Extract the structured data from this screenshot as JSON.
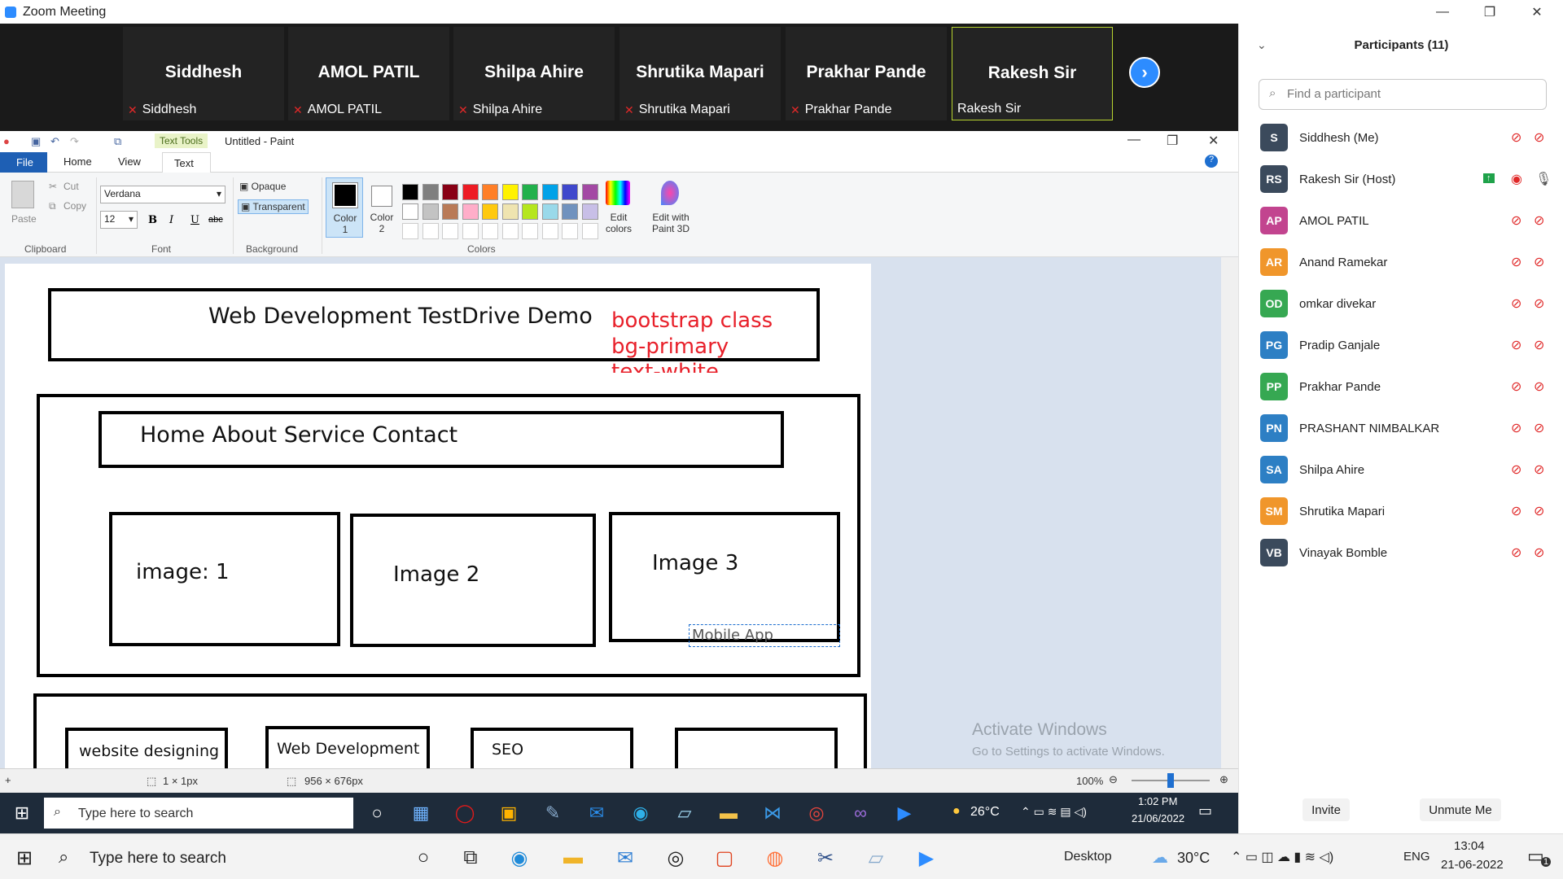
{
  "zoom": {
    "title": "Zoom Meeting",
    "minimize": "—",
    "restore": "❐",
    "close": "✕"
  },
  "strip": {
    "tiles": [
      {
        "name": "Siddhesh",
        "label": "Siddhesh",
        "muted": true
      },
      {
        "name": "AMOL PATIL",
        "label": "AMOL PATIL",
        "muted": true
      },
      {
        "name": "Shilpa Ahire",
        "label": "Shilpa Ahire",
        "muted": true
      },
      {
        "name": "Shrutika Mapari",
        "label": "Shrutika Mapari",
        "muted": true
      },
      {
        "name": "Prakhar Pande",
        "label": "Prakhar Pande",
        "muted": true
      },
      {
        "name": "Rakesh Sir",
        "label": "Rakesh Sir",
        "muted": false
      }
    ],
    "next": "›"
  },
  "paint": {
    "title": "Untitled - Paint",
    "tools_tab": "Text Tools",
    "tabs": {
      "file": "File",
      "home": "Home",
      "view": "View",
      "text": "Text"
    },
    "clipboard": {
      "paste": "Paste",
      "cut": "Cut",
      "copy": "Copy",
      "group": "Clipboard"
    },
    "font": {
      "family": "Verdana",
      "size": "12",
      "bold": "B",
      "italic": "I",
      "underline": "U",
      "strike": "abc",
      "group": "Font"
    },
    "background": {
      "opaque": "Opaque",
      "transparent": "Transparent",
      "group": "Background"
    },
    "colors": {
      "color1": "Color 1",
      "color2": "Color 2",
      "edit": "Edit colors",
      "paint3d": "Edit with Paint 3D",
      "group": "Colors",
      "row1": [
        "#000000",
        "#7f7f7f",
        "#880015",
        "#ed1c24",
        "#ff7f27",
        "#fff200",
        "#22b14c",
        "#00a2e8",
        "#3f48cc",
        "#a349a4"
      ],
      "row2": [
        "#ffffff",
        "#c3c3c3",
        "#b97a57",
        "#ffaec9",
        "#ffc90e",
        "#efe4b0",
        "#b5e61d",
        "#99d9ea",
        "#7092be",
        "#c8bfe7"
      ]
    },
    "canvas": {
      "header": "Web Development TestDrive Demo",
      "note1": "bootstrap class",
      "note2": "bg-primary",
      "note3": "text-white",
      "nav": "Home About Service Contact",
      "img1": "image: 1",
      "img2": "Image 2",
      "img3": "Image 3",
      "textbox": "Mobile App",
      "svc1": "website designing",
      "svc2": "Web Development",
      "svc3": "SEO",
      "watermark1": "Activate Windows",
      "watermark2": "Go to Settings to activate Windows."
    },
    "status": {
      "pixel": "1 × 1px",
      "size": "956 × 676px",
      "zoom": "100%"
    }
  },
  "innerTaskbar": {
    "search": "Type here to search",
    "weather": "26°C",
    "time": "1:02 PM",
    "date": "21/06/2022"
  },
  "participants": {
    "title": "Participants (11)",
    "search_placeholder": "Find a participant",
    "list": [
      {
        "initials": "S",
        "name": "Siddhesh (Me)",
        "color": "#3b4a5c"
      },
      {
        "initials": "RS",
        "name": "Rakesh Sir (Host)",
        "color": "#3b4a5c"
      },
      {
        "initials": "AP",
        "name": "AMOL PATIL",
        "color": "#c2448f"
      },
      {
        "initials": "AR",
        "name": "Anand Ramekar",
        "color": "#f0962b"
      },
      {
        "initials": "OD",
        "name": "omkar divekar",
        "color": "#36a852"
      },
      {
        "initials": "PG",
        "name": "Pradip Ganjale",
        "color": "#2d7fc4"
      },
      {
        "initials": "PP",
        "name": "Prakhar Pande",
        "color": "#36a852"
      },
      {
        "initials": "PN",
        "name": "PRASHANT NIMBALKAR",
        "color": "#2d7fc4"
      },
      {
        "initials": "SA",
        "name": "Shilpa Ahire",
        "color": "#2d7fc4"
      },
      {
        "initials": "SM",
        "name": "Shrutika Mapari",
        "color": "#f0962b"
      },
      {
        "initials": "VB",
        "name": "Vinayak Bomble",
        "color": "#3b4a5c"
      }
    ],
    "invite": "Invite",
    "unmute": "Unmute Me"
  },
  "taskbar": {
    "search": "Type here to search",
    "desktop": "Desktop",
    "weather": "30°C",
    "lang": "ENG",
    "time": "13:04",
    "date": "21-06-2022",
    "notif": "1"
  }
}
